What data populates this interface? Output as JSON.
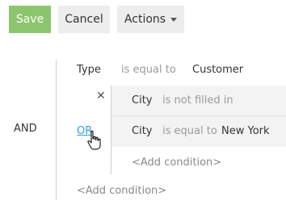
{
  "toolbar": {
    "save_label": "Save",
    "cancel_label": "Cancel",
    "actions_label": "Actions",
    "colors": {
      "save_bg": "#8cc56e",
      "button_bg": "#ededed",
      "link": "#3a9bd5"
    }
  },
  "filter": {
    "group_operator": "AND",
    "conditions": [
      {
        "field": "Type",
        "operator": "is equal to",
        "value": "Customer"
      }
    ],
    "nested_group": {
      "operator": "OR",
      "conditions": [
        {
          "field": "City",
          "operator": "is not filled in",
          "value": ""
        },
        {
          "field": "City",
          "operator": "is equal to",
          "value": "New York"
        }
      ],
      "add_condition_label": "<Add condition>"
    },
    "add_condition_label": "<Add condition>"
  }
}
